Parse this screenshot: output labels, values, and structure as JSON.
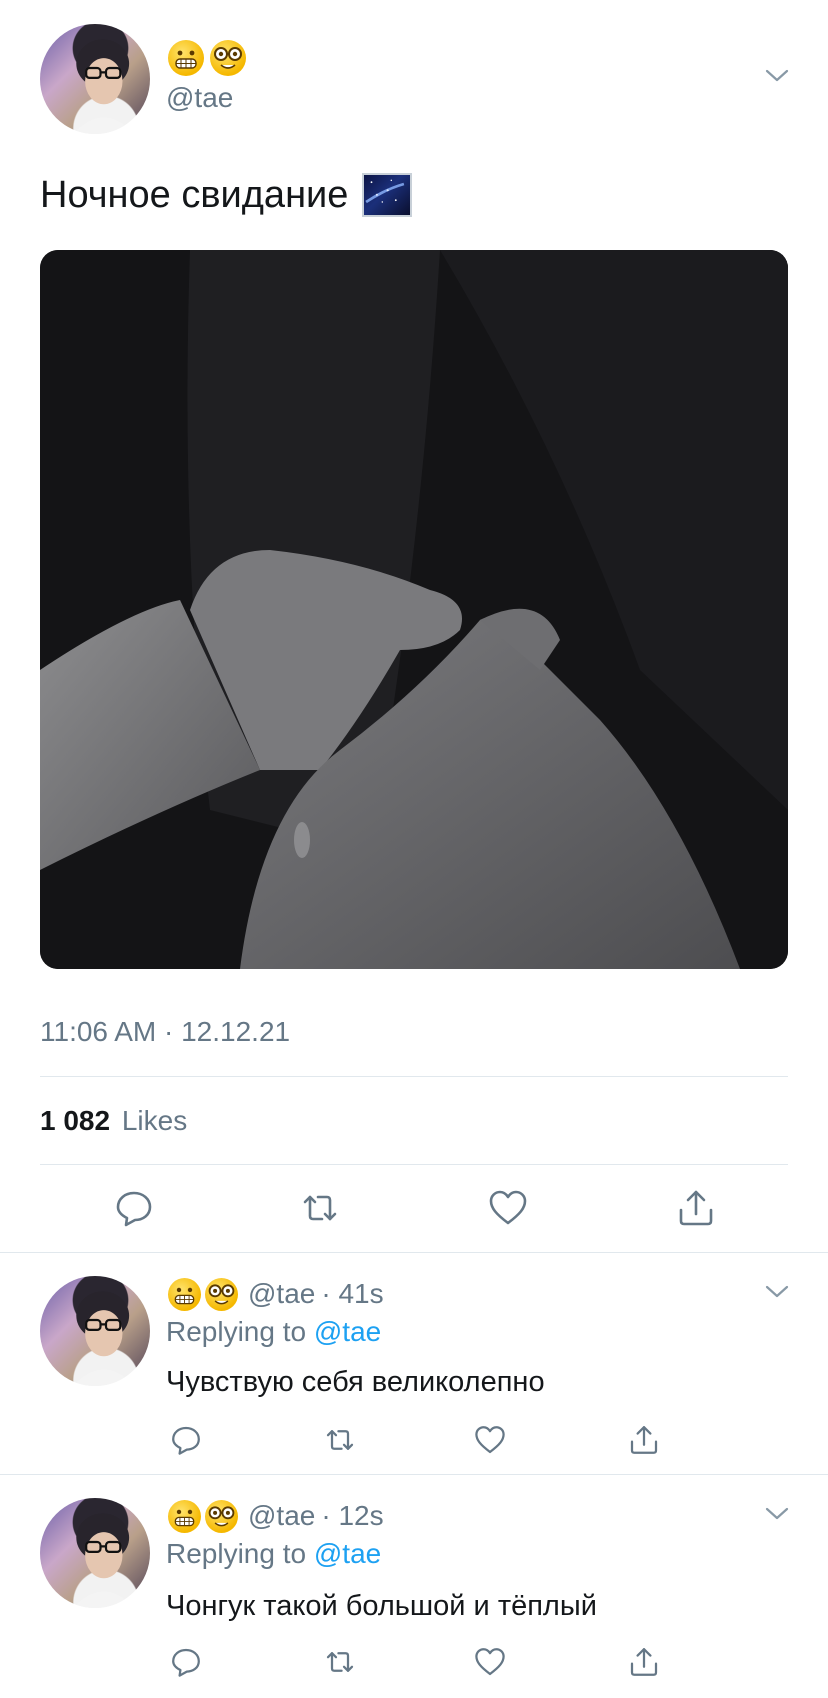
{
  "tweet": {
    "handle": "@tae",
    "text": "Ночное свидание",
    "text_emoji": "milky-way",
    "timestamp": "11:06 AM · 12.12.21",
    "likes_count": "1 082",
    "likes_label": "Likes"
  },
  "replies": [
    {
      "handle": "@tae",
      "time": "· 41s",
      "replying_prefix": "Replying to",
      "replying_to": "@tae",
      "text": "Чувствую себя великолепно"
    },
    {
      "handle": "@tae",
      "time": "· 12s",
      "replying_prefix": "Replying to",
      "replying_to": "@tae",
      "text": "Чонгук такой большой и тёплый"
    }
  ],
  "icons": {
    "name_emoji_1": "grimacing-face-emoji",
    "name_emoji_2": "nerd-face-emoji",
    "menu": "chevron-down-icon",
    "reply": "reply-icon",
    "retweet": "retweet-icon",
    "like": "heart-icon",
    "share": "share-icon"
  },
  "colors": {
    "text": "#14171a",
    "secondary": "#657786",
    "link": "#1da1f2",
    "divider": "#e1e8ed"
  }
}
